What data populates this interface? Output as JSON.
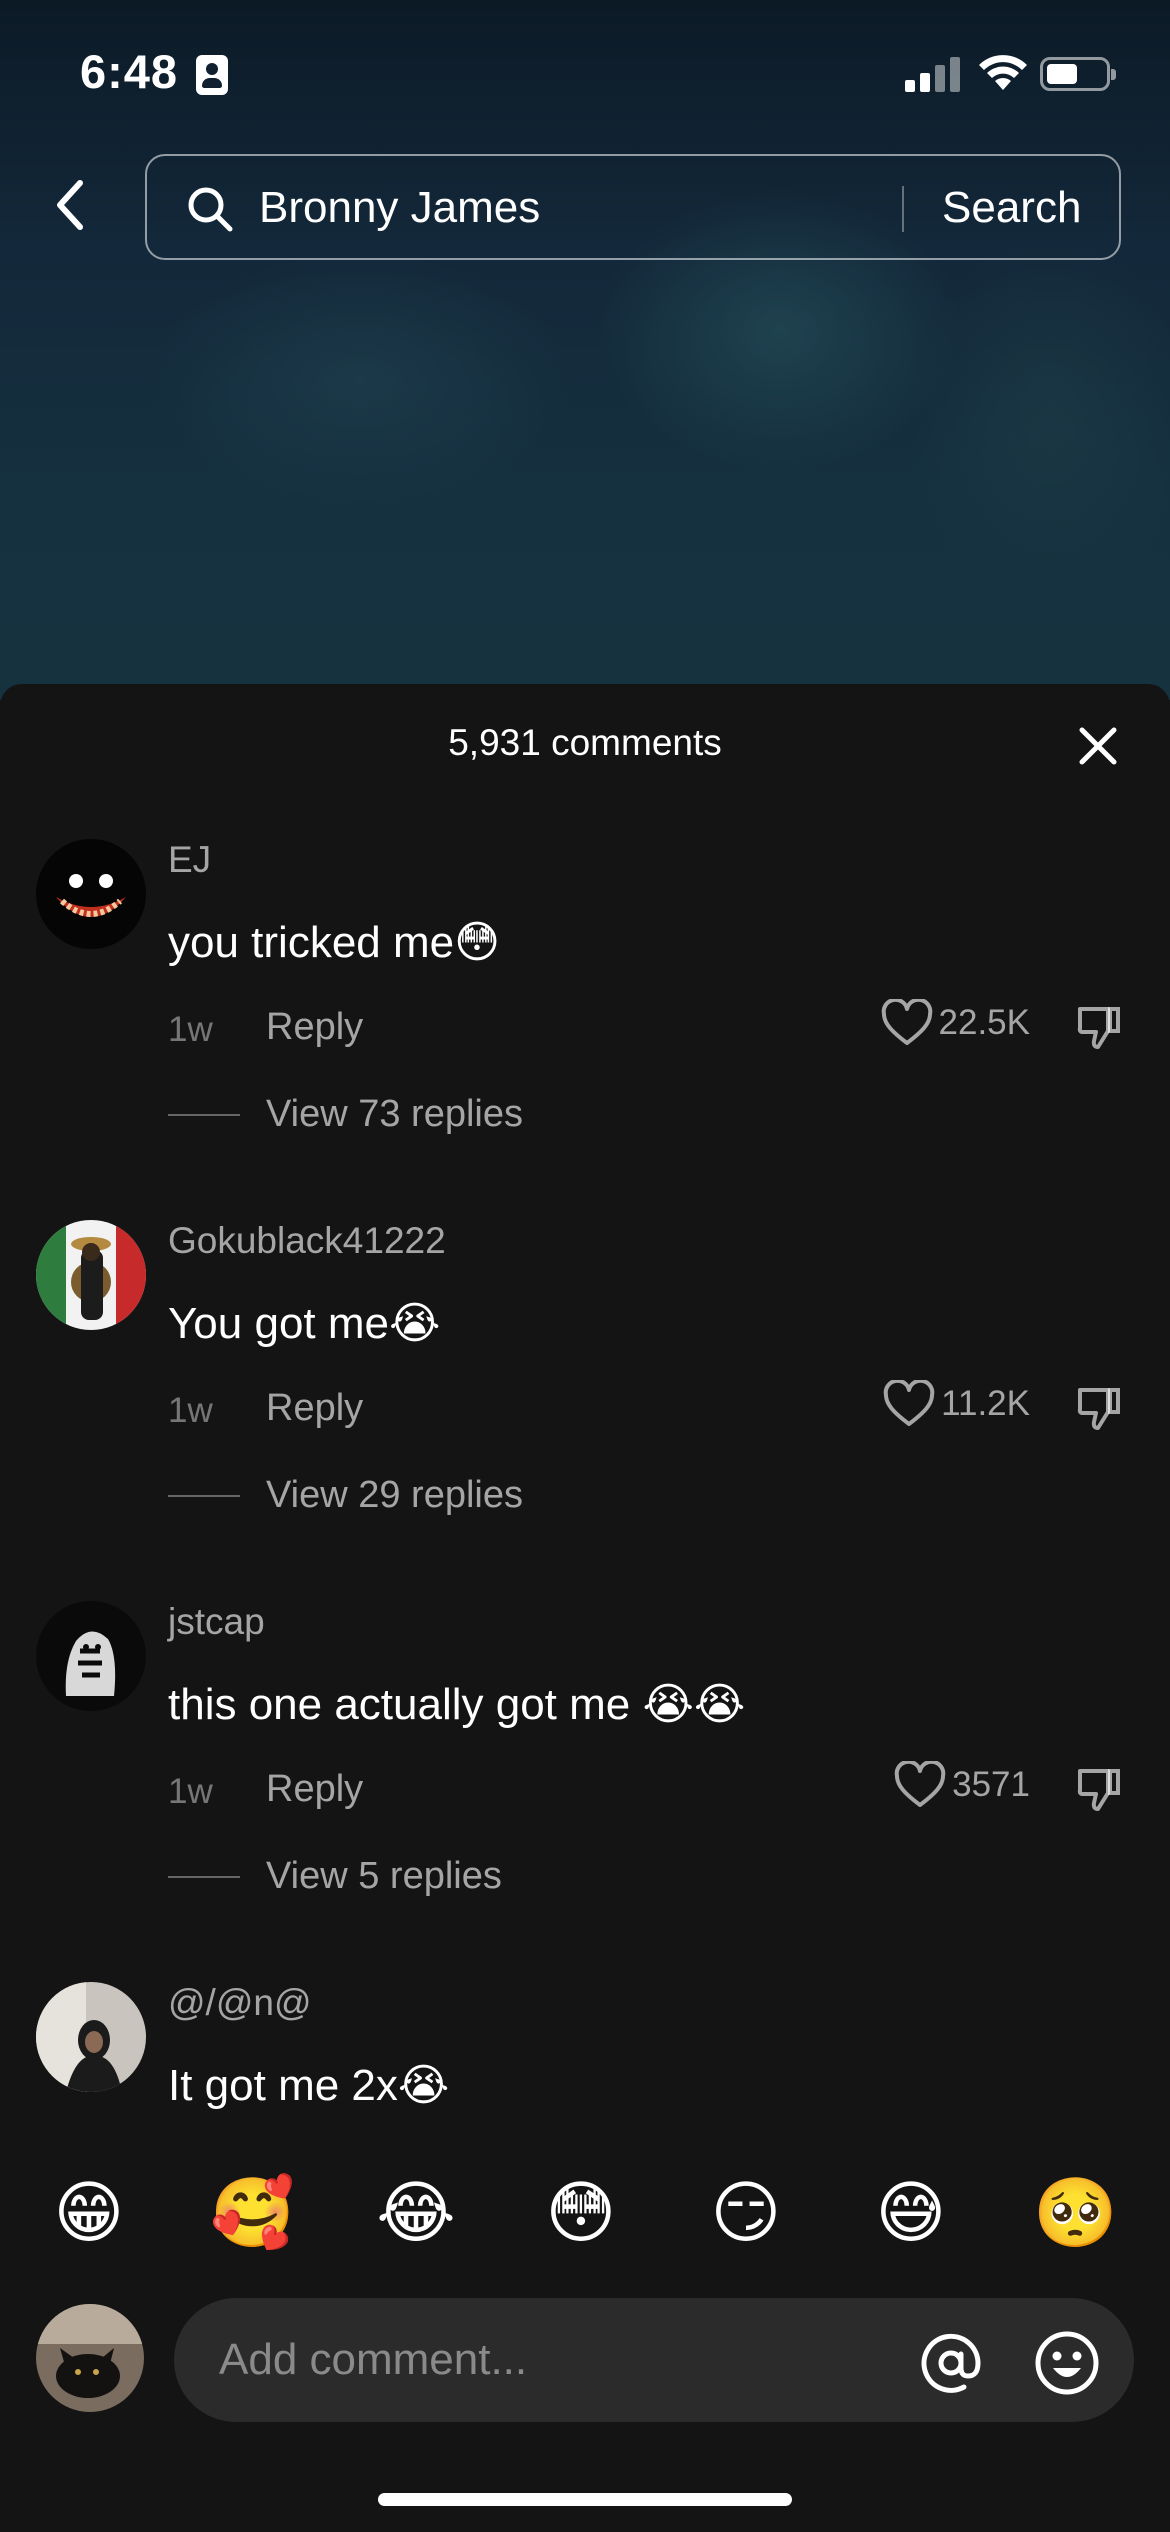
{
  "status_bar": {
    "time": "6:48"
  },
  "search": {
    "query": "Bronny James",
    "button_label": "Search"
  },
  "sheet": {
    "title": "5,931 comments"
  },
  "comments": [
    {
      "username": "EJ",
      "text": "you tricked me😳",
      "time": "1w",
      "reply_label": "Reply",
      "likes": "22.5K",
      "view_replies": "View 73 replies"
    },
    {
      "username": "Gokublack41222",
      "text": "You got me😭",
      "time": "1w",
      "reply_label": "Reply",
      "likes": "11.2K",
      "view_replies": "View 29 replies"
    },
    {
      "username": "jstcap",
      "text": "this one actually got me 😭😭",
      "time": "1w",
      "reply_label": "Reply",
      "likes": "3571",
      "view_replies": "View 5 replies"
    },
    {
      "username": "@/@n@",
      "text": "It got me 2x😭"
    }
  ],
  "emoji_bar": [
    "😁",
    "🥰",
    "😂",
    "😳",
    "😏",
    "😅",
    "🥺"
  ],
  "composer": {
    "placeholder": "Add comment..."
  },
  "colors": {
    "background": "#141414",
    "input_background": "#2b2b2b",
    "text_muted": "#9e9e9e"
  }
}
